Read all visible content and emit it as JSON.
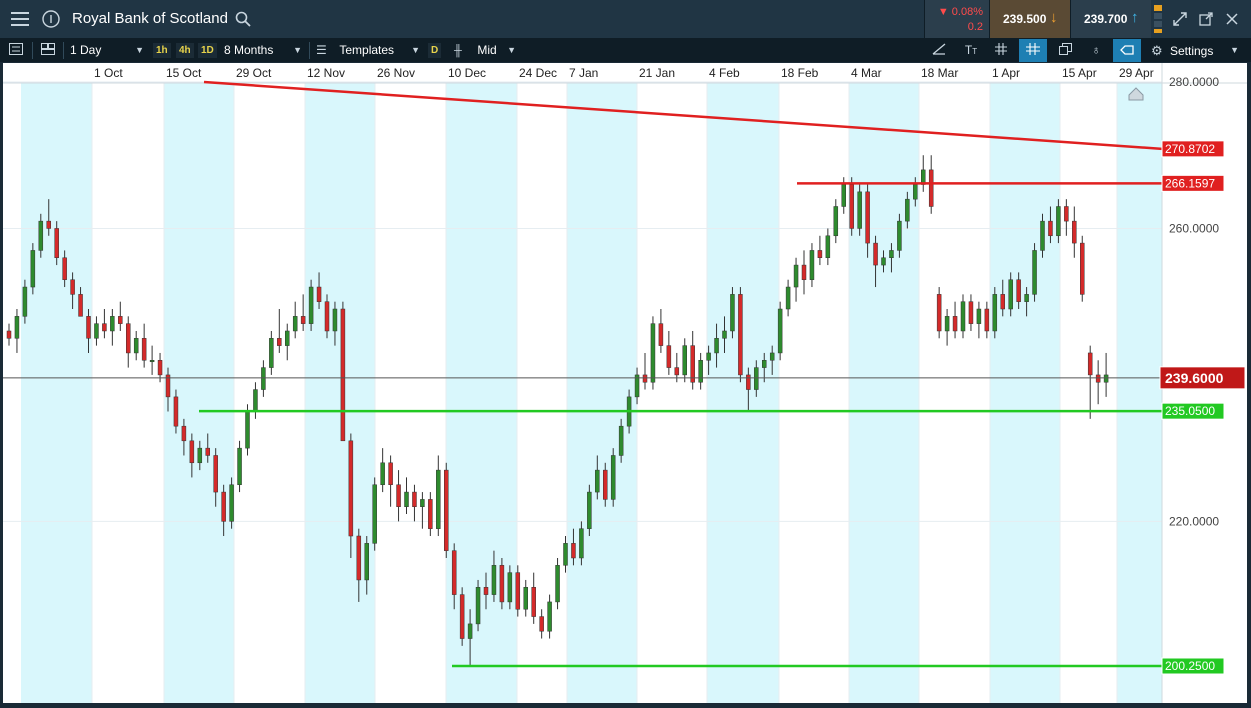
{
  "header": {
    "instrument": "Royal Bank of Scotland",
    "change_pct": "▼ 0.08%",
    "change_abs": "0.2",
    "sell_price": "239.500",
    "buy_price": "239.700"
  },
  "toolbar": {
    "interval": "1 Day",
    "quick_1h": "1h",
    "quick_4h": "4h",
    "quick_1d": "1D",
    "range": "8 Months",
    "templates": "Templates",
    "d_badge": "D",
    "price_type": "Mid",
    "settings": "Settings"
  },
  "colors": {
    "candle_up": "#2e8b2e",
    "candle_down": "#d42a2a",
    "resistance": "#e02020",
    "support": "#22c922",
    "band": "#d9f7fc"
  },
  "chart_data": {
    "type": "candlestick",
    "title": "",
    "x_axis": {
      "ticks": [
        "1 Oct",
        "15 Oct",
        "29 Oct",
        "12 Nov",
        "26 Nov",
        "10 Dec",
        "24 Dec",
        "7 Jan",
        "21 Jan",
        "4 Feb",
        "18 Feb",
        "4 Mar",
        "18 Mar",
        "1 Apr",
        "15 Apr",
        "29 Apr"
      ]
    },
    "y_axis": {
      "range": [
        200.25,
        280
      ],
      "ticks": [
        "280.0000",
        "260.0000",
        "220.0000"
      ]
    },
    "current_price": "239.6000",
    "lines": [
      {
        "label": "270.8702",
        "kind": "trendline",
        "color": "red",
        "from": [
          "15 Oct",
          280.0
        ],
        "to": [
          "29 Apr",
          270.8702
        ]
      },
      {
        "label": "266.1597",
        "kind": "horizontal",
        "color": "red",
        "value": 266.1597,
        "from": "18 Feb"
      },
      {
        "label": "235.0500",
        "kind": "horizontal",
        "color": "green",
        "value": 235.05,
        "from": "15 Oct"
      },
      {
        "label": "200.2500",
        "kind": "horizontal",
        "color": "green",
        "value": 200.25,
        "from": "10 Dec"
      }
    ],
    "series": [
      {
        "values": [
          [
            246,
            247,
            244,
            245
          ],
          [
            245,
            249,
            243,
            248
          ],
          [
            248,
            253,
            247,
            252
          ],
          [
            252,
            258,
            251,
            257
          ],
          [
            257,
            262,
            256,
            261
          ],
          [
            261,
            264,
            259,
            260
          ],
          [
            260,
            261,
            255,
            256
          ],
          [
            256,
            257,
            252,
            253
          ],
          [
            253,
            254,
            249,
            251
          ],
          [
            251,
            252,
            248,
            248
          ],
          [
            248,
            249,
            243,
            245
          ],
          [
            245,
            248,
            244,
            247
          ],
          [
            247,
            249,
            245,
            246
          ],
          [
            246,
            249,
            244,
            248
          ],
          [
            248,
            250,
            246,
            247
          ],
          [
            247,
            248,
            241,
            243
          ],
          [
            243,
            246,
            242,
            245
          ],
          [
            245,
            247,
            241,
            242
          ],
          [
            242,
            244,
            240,
            242
          ],
          [
            242,
            243,
            239,
            240
          ],
          [
            240,
            241,
            235,
            237
          ],
          [
            237,
            238,
            232,
            233
          ],
          [
            233,
            234,
            229,
            231
          ],
          [
            231,
            232,
            226,
            228
          ],
          [
            228,
            231,
            227,
            230
          ],
          [
            230,
            232,
            228,
            229
          ],
          [
            229,
            230,
            222,
            224
          ],
          [
            224,
            225,
            218,
            220
          ],
          [
            220,
            226,
            219,
            225
          ],
          [
            225,
            231,
            224,
            230
          ],
          [
            230,
            236,
            229,
            235
          ],
          [
            235,
            239,
            234,
            238
          ],
          [
            238,
            242,
            237,
            241
          ],
          [
            241,
            246,
            240,
            245
          ],
          [
            245,
            249,
            243,
            244
          ],
          [
            244,
            247,
            242,
            246
          ],
          [
            246,
            250,
            245,
            248
          ],
          [
            248,
            251,
            246,
            247
          ],
          [
            247,
            253,
            246,
            252
          ],
          [
            252,
            254,
            249,
            250
          ],
          [
            250,
            251,
            245,
            246
          ],
          [
            246,
            250,
            244,
            249
          ],
          [
            249,
            250,
            243,
            231
          ],
          [
            231,
            232,
            215,
            218
          ],
          [
            218,
            219,
            209,
            212
          ],
          [
            212,
            218,
            210,
            217
          ],
          [
            217,
            226,
            216,
            225
          ],
          [
            225,
            230,
            224,
            228
          ],
          [
            228,
            229,
            222,
            225
          ],
          [
            225,
            227,
            220,
            222
          ],
          [
            222,
            226,
            221,
            224
          ],
          [
            224,
            225,
            220,
            222
          ],
          [
            222,
            224,
            219,
            223
          ],
          [
            223,
            224,
            218,
            219
          ],
          [
            219,
            229,
            218,
            227
          ],
          [
            227,
            228,
            215,
            216
          ],
          [
            216,
            217,
            208,
            210
          ],
          [
            210,
            211,
            203,
            204
          ],
          [
            204,
            208,
            200.25,
            206
          ],
          [
            206,
            212,
            205,
            211
          ],
          [
            211,
            213,
            208,
            210
          ],
          [
            210,
            216,
            209,
            214
          ],
          [
            214,
            215,
            208,
            209
          ],
          [
            209,
            214,
            208,
            213
          ],
          [
            213,
            214,
            207,
            208
          ],
          [
            208,
            212,
            207,
            211
          ],
          [
            211,
            213,
            206,
            207
          ],
          [
            207,
            208,
            204,
            205
          ],
          [
            205,
            210,
            204,
            209
          ],
          [
            209,
            215,
            208,
            214
          ],
          [
            214,
            218,
            213,
            217
          ],
          [
            217,
            219,
            214,
            215
          ],
          [
            215,
            220,
            214,
            219
          ],
          [
            219,
            225,
            218,
            224
          ],
          [
            224,
            229,
            223,
            227
          ],
          [
            227,
            228,
            222,
            223
          ],
          [
            223,
            230,
            222,
            229
          ],
          [
            229,
            234,
            228,
            233
          ],
          [
            233,
            238,
            232,
            237
          ],
          [
            237,
            241,
            236,
            240
          ],
          [
            240,
            243,
            238,
            239
          ],
          [
            239,
            248,
            238,
            247
          ],
          [
            247,
            249,
            243,
            244
          ],
          [
            244,
            246,
            240,
            241
          ],
          [
            241,
            243,
            239,
            240
          ],
          [
            240,
            245,
            239,
            244
          ],
          [
            244,
            246,
            238,
            239
          ],
          [
            239,
            243,
            238,
            242
          ],
          [
            242,
            244,
            240,
            243
          ],
          [
            243,
            247,
            241,
            245
          ],
          [
            245,
            248,
            243,
            246
          ],
          [
            246,
            252,
            245,
            251
          ],
          [
            251,
            252,
            239,
            240
          ],
          [
            240,
            241,
            235,
            238
          ],
          [
            238,
            242,
            237,
            241
          ],
          [
            241,
            243,
            239,
            242
          ],
          [
            242,
            244,
            240,
            243
          ],
          [
            243,
            250,
            242,
            249
          ],
          [
            249,
            253,
            248,
            252
          ],
          [
            252,
            256,
            250,
            255
          ],
          [
            255,
            257,
            251,
            253
          ],
          [
            253,
            258,
            252,
            257
          ],
          [
            257,
            259,
            255,
            256
          ],
          [
            256,
            260,
            255,
            259
          ],
          [
            259,
            264,
            258,
            263
          ],
          [
            263,
            267,
            262,
            266
          ],
          [
            266,
            267,
            259,
            260
          ],
          [
            260,
            266,
            259,
            265
          ],
          [
            265,
            266,
            256,
            258
          ],
          [
            258,
            259,
            252,
            255
          ],
          [
            255,
            257,
            254,
            256
          ],
          [
            256,
            258,
            254,
            257
          ],
          [
            257,
            262,
            256,
            261
          ],
          [
            261,
            265,
            260,
            264
          ],
          [
            264,
            267,
            263,
            266
          ],
          [
            266,
            270,
            265,
            268
          ],
          [
            268,
            270,
            262,
            263
          ],
          [
            251,
            252,
            245,
            246
          ],
          [
            246,
            249,
            244,
            248
          ],
          [
            248,
            250,
            245,
            246
          ],
          [
            246,
            251,
            245,
            250
          ],
          [
            250,
            251,
            246,
            247
          ],
          [
            247,
            250,
            245,
            249
          ],
          [
            249,
            250,
            245,
            246
          ],
          [
            246,
            252,
            245,
            251
          ],
          [
            251,
            253,
            248,
            249
          ],
          [
            249,
            254,
            248,
            253
          ],
          [
            253,
            254,
            249,
            250
          ],
          [
            250,
            252,
            248,
            251
          ],
          [
            251,
            258,
            250,
            257
          ],
          [
            257,
            262,
            256,
            261
          ],
          [
            261,
            263,
            258,
            259
          ],
          [
            259,
            264,
            258,
            263
          ],
          [
            263,
            264,
            259,
            261
          ],
          [
            261,
            263,
            256,
            258
          ],
          [
            258,
            259,
            250,
            251
          ],
          [
            243,
            244,
            234,
            240
          ],
          [
            240,
            242,
            236,
            239
          ],
          [
            239,
            243,
            237,
            240
          ]
        ]
      }
    ]
  }
}
